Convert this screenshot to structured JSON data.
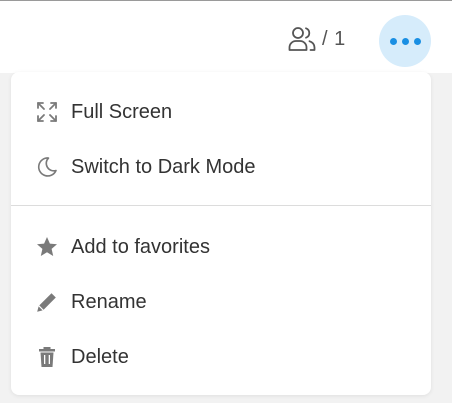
{
  "colors": {
    "accent": "#1a8fe3",
    "accent_bg": "#d6ecfb",
    "icon": "#7a7a7a",
    "text": "#333333"
  },
  "header": {
    "participant_icon": "users-icon",
    "participant_count": "/ 1",
    "more_icon": "more-horizontal-icon"
  },
  "menu": {
    "items": [
      {
        "label": "Full Screen",
        "icon": "expand-icon"
      },
      {
        "label": "Switch to Dark Mode",
        "icon": "moon-icon"
      },
      {
        "label": "Add to favorites",
        "icon": "star-icon"
      },
      {
        "label": "Rename",
        "icon": "pencil-icon"
      },
      {
        "label": "Delete",
        "icon": "trash-icon"
      }
    ]
  }
}
